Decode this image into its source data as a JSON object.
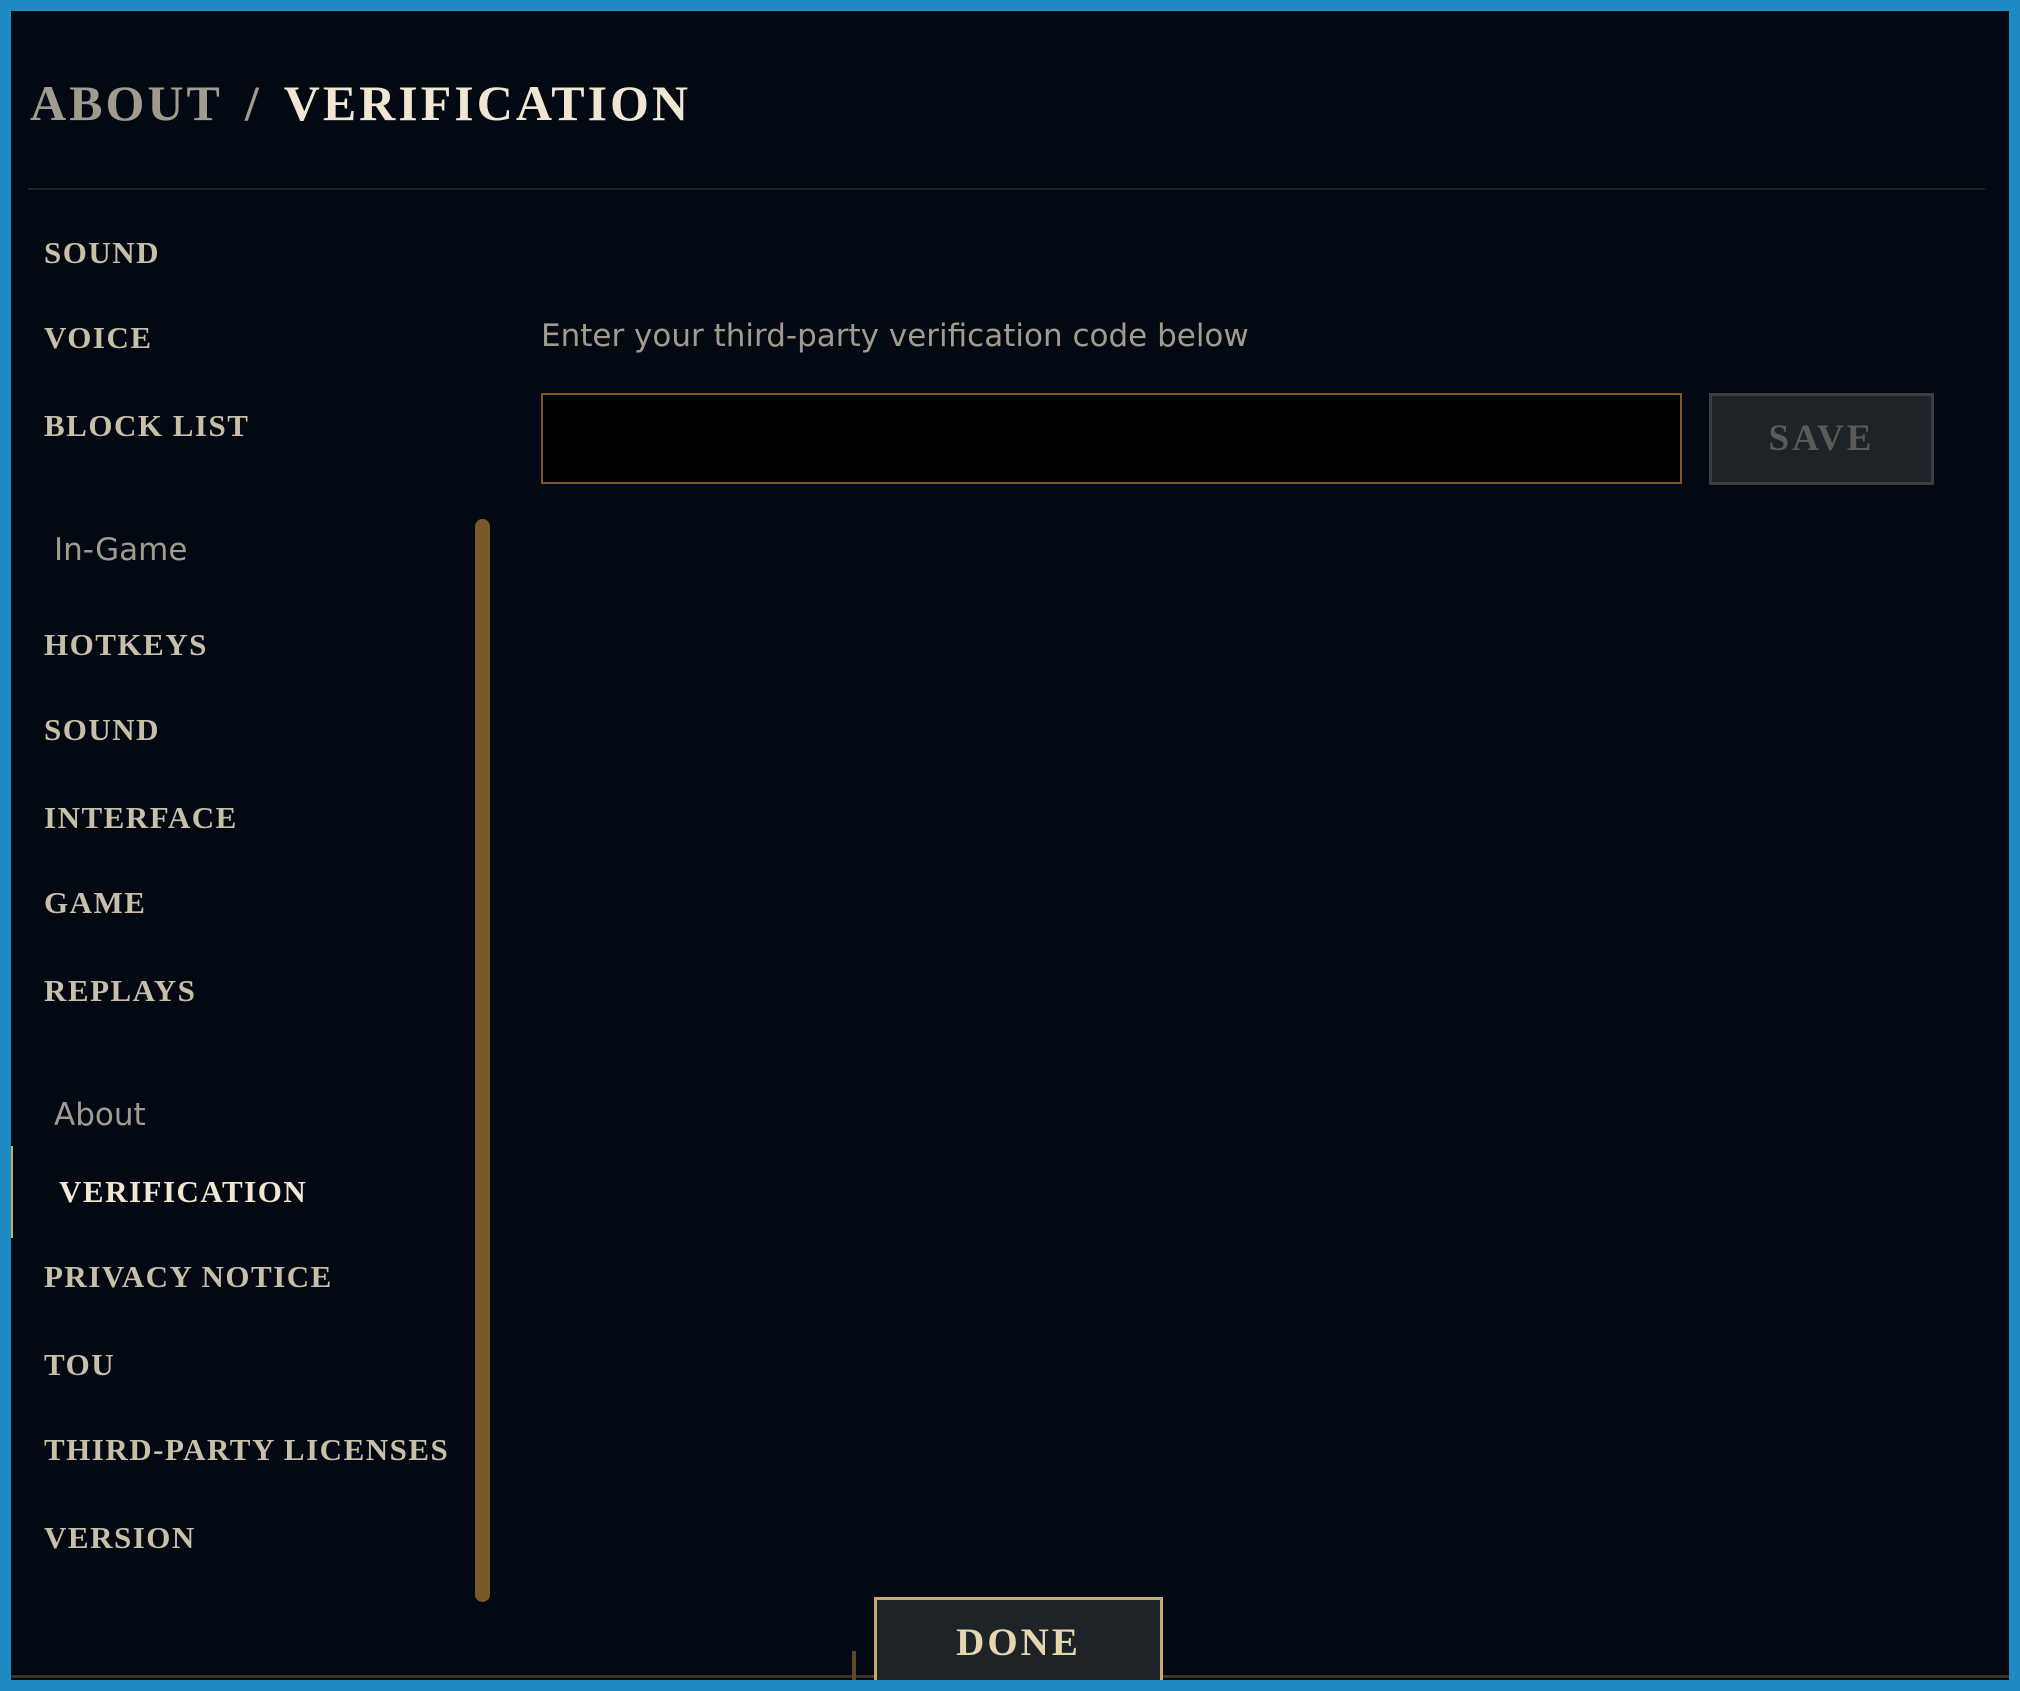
{
  "header": {
    "breadcrumb_parent": "ABOUT",
    "breadcrumb_separator": "/",
    "breadcrumb_current": "VERIFICATION"
  },
  "sidebar": {
    "client_items": [
      {
        "label": "SOUND"
      },
      {
        "label": "VOICE"
      },
      {
        "label": "BLOCK LIST"
      }
    ],
    "ingame_header": "In-Game",
    "ingame_items": [
      {
        "label": "HOTKEYS"
      },
      {
        "label": "SOUND"
      },
      {
        "label": "INTERFACE"
      },
      {
        "label": "GAME"
      },
      {
        "label": "REPLAYS"
      }
    ],
    "about_header": "About",
    "about_items": [
      {
        "label": "VERIFICATION",
        "active": true
      },
      {
        "label": "PRIVACY NOTICE"
      },
      {
        "label": "TOU"
      },
      {
        "label": "THIRD-PARTY LICENSES"
      },
      {
        "label": "VERSION"
      }
    ]
  },
  "verification": {
    "prompt": "Enter your third-party verification code below",
    "input_value": "",
    "save_label": "SAVE"
  },
  "footer": {
    "done_label": "DONE"
  },
  "colors": {
    "background": "#030913",
    "frame": "#1e8bc3",
    "gold_accent": "#c8aa6e",
    "gold_dark": "#785a28",
    "text_primary": "#f0e6d2",
    "text_muted": "#a09b8c",
    "disabled_text": "#5b5a56"
  }
}
